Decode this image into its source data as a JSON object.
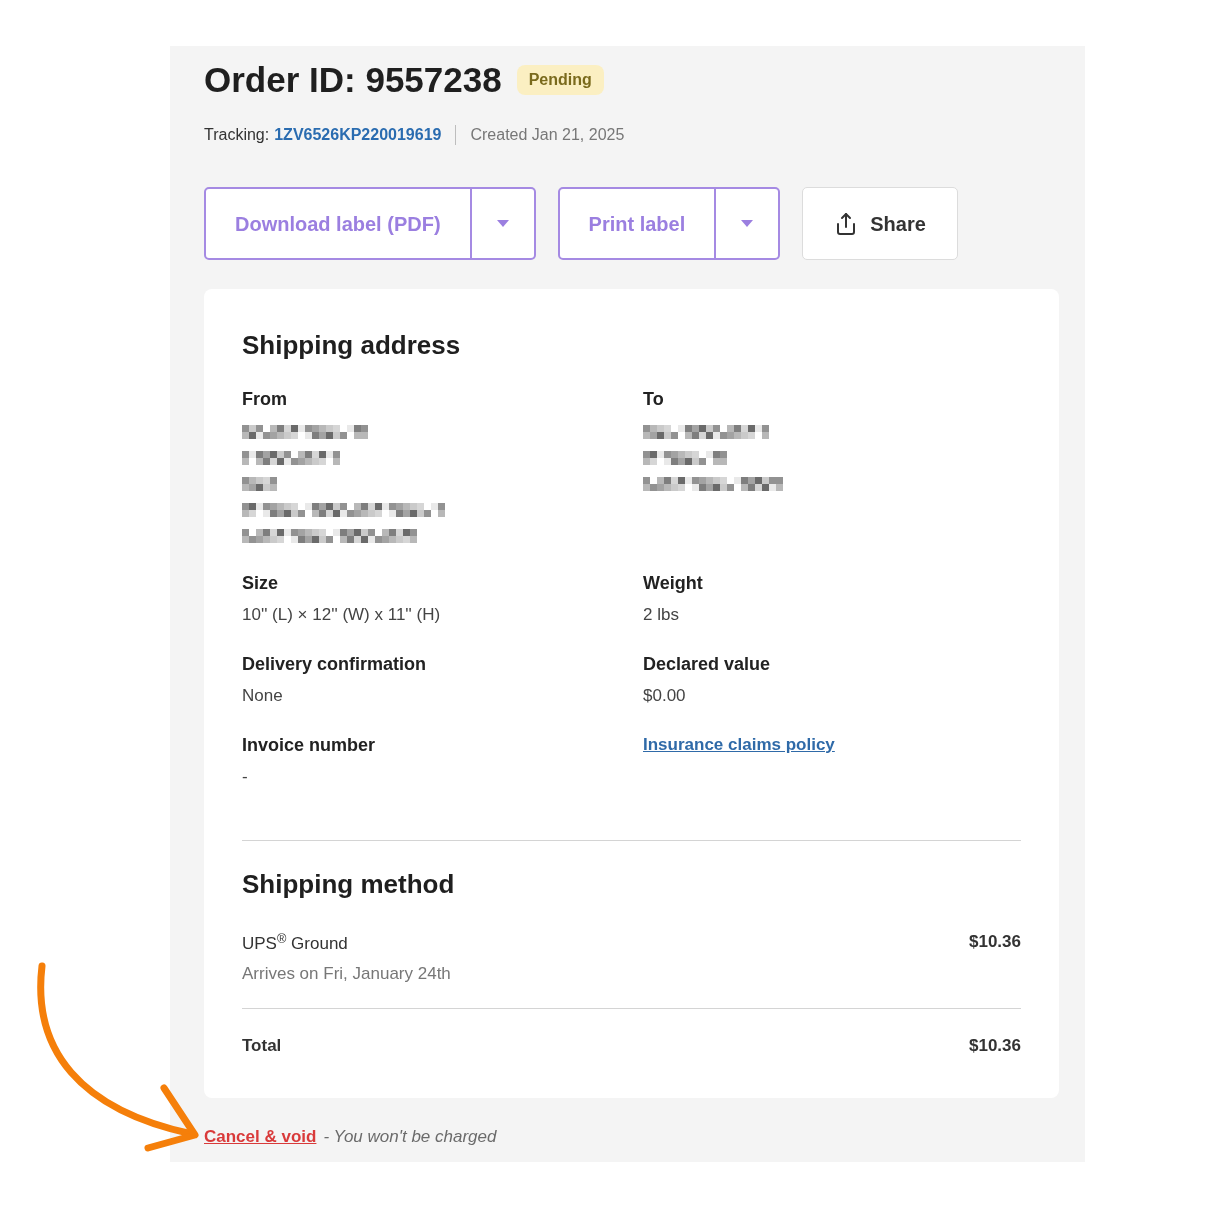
{
  "header": {
    "title": "Order ID: 9557238",
    "status": {
      "kind": "pending",
      "label": "Pending"
    },
    "tracking_label": "Tracking:",
    "tracking_number": "1ZV6526KP220019619",
    "created": "Created Jan 21, 2025"
  },
  "actions": [
    {
      "kind": "split",
      "label": "Download label (PDF)"
    },
    {
      "kind": "split",
      "label": "Print label"
    },
    {
      "kind": "share",
      "label": "Share"
    }
  ],
  "shipping_address": {
    "title": "Shipping address",
    "from": {
      "label": "From",
      "lines": [
        {
          "kind": "redacted"
        },
        {
          "kind": "redacted"
        },
        {
          "kind": "redacted"
        },
        {
          "kind": "redacted"
        },
        {
          "kind": "redacted"
        }
      ]
    },
    "to": {
      "label": "To",
      "lines": [
        {
          "kind": "redacted"
        },
        {
          "kind": "redacted"
        },
        {
          "kind": "redacted"
        }
      ]
    },
    "fields": [
      {
        "kind": "field",
        "label": "Size",
        "value": "10'' (L) × 12'' (W) x 11'' (H)"
      },
      {
        "kind": "field",
        "label": "Weight",
        "value": "2 lbs"
      },
      {
        "kind": "field",
        "label": "Delivery confirmation",
        "value": "None"
      },
      {
        "kind": "field",
        "label": "Declared value",
        "value": "$0.00"
      },
      {
        "kind": "field",
        "label": "Invoice number",
        "value": "-"
      },
      {
        "kind": "link",
        "label": "Insurance claims policy"
      }
    ]
  },
  "shipping_method": {
    "title": "Shipping method",
    "service": "UPS$^{®}$ Ground",
    "eta": "Arrives on Fri, January 24th",
    "price": "$10.36",
    "total_label": "Total",
    "total": "$10.36"
  },
  "footer": {
    "cancel_link": "Cancel & void",
    "note": "- You won't be charged"
  },
  "annotation": {
    "kind": "curved-arrow"
  }
}
